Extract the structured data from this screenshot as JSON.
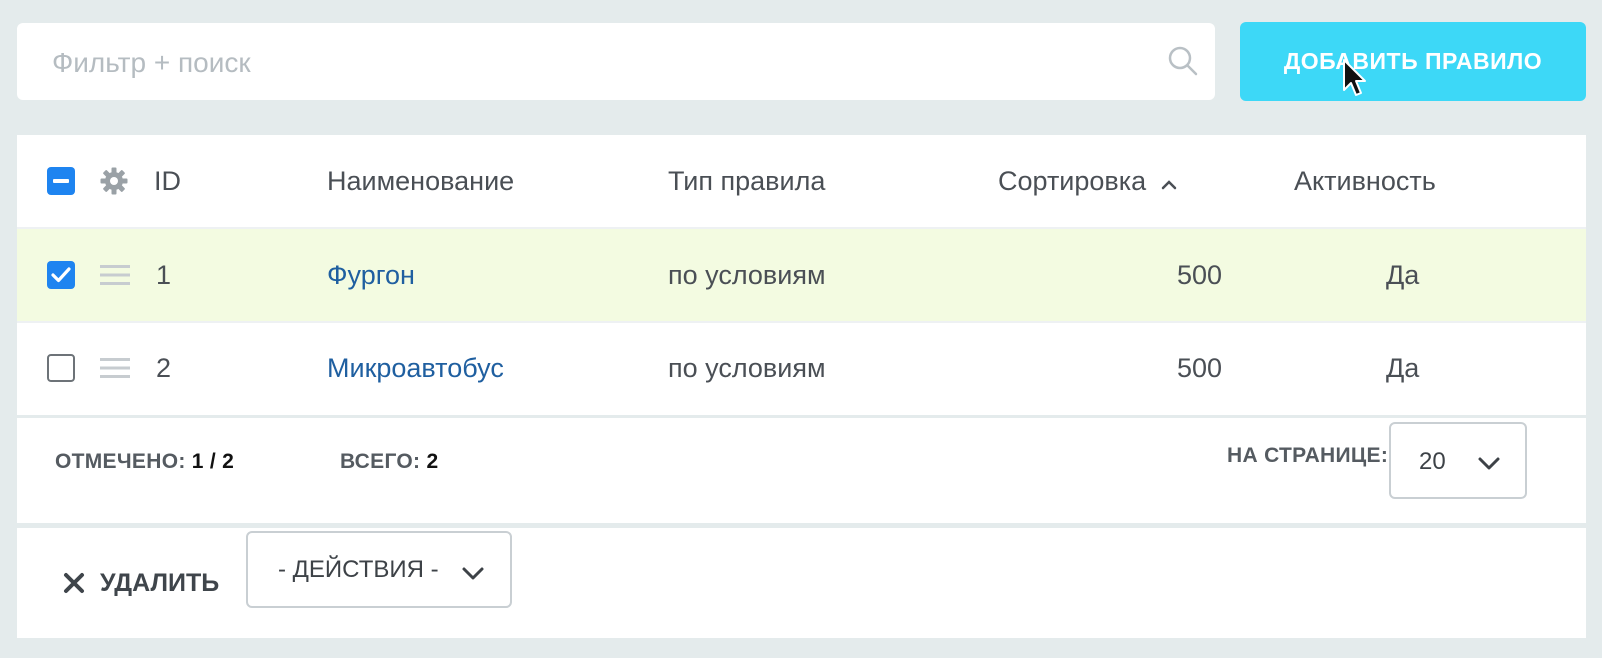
{
  "search": {
    "placeholder": "Фильтр + поиск"
  },
  "toolbar": {
    "add_rule_label": "ДОБАВИТЬ ПРАВИЛО"
  },
  "table": {
    "columns": [
      "ID",
      "Наименование",
      "Тип правила",
      "Сортировка",
      "Активность"
    ],
    "sort_column": "Сортировка",
    "sort_direction": "ascending",
    "rows": [
      {
        "id": "1",
        "name": "Фургон",
        "type": "по условиям",
        "sort": "500",
        "active": "Да",
        "checked": true
      },
      {
        "id": "2",
        "name": "Микроавтобус",
        "type": "по условиям",
        "sort": "500",
        "active": "Да",
        "checked": false
      }
    ]
  },
  "footer": {
    "selected_label": "ОТМЕЧЕНО:",
    "selected_value": "1 / 2",
    "total_label": "ВСЕГО:",
    "total_value": "2",
    "per_page_label": "НА СТРАНИЦЕ:",
    "per_page_value": "20"
  },
  "actions": {
    "delete_label": "УДАЛИТЬ",
    "actions_select": "- ДЕЙСТВИЯ -"
  },
  "colors": {
    "accent": "#3dd8f7",
    "checkbox": "#1e84f0",
    "selected_row": "#f3fbe1",
    "link": "#1f5fa0"
  }
}
